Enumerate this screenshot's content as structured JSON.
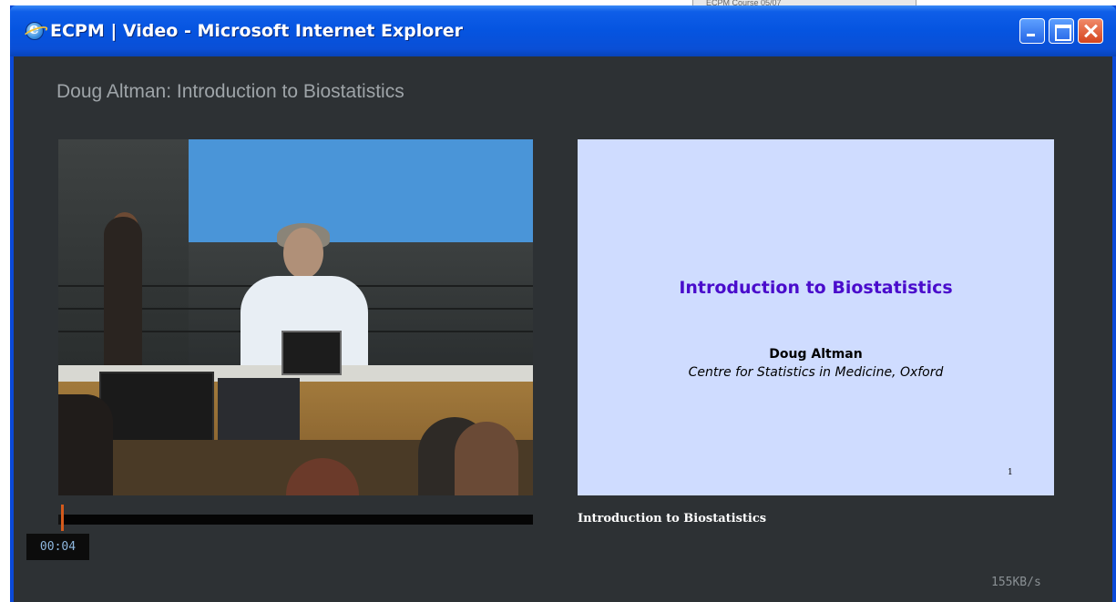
{
  "background": {
    "tab_label": "ECPM Course 05/07"
  },
  "window": {
    "title": "ECPM | Video - Microsoft Internet Explorer",
    "icon": "internet-explorer-icon",
    "controls": [
      "minimize",
      "maximize",
      "close"
    ]
  },
  "page": {
    "title": "Doug Altman: Introduction to Biostatistics"
  },
  "player": {
    "current_time": "00:04",
    "progress_fraction": 0.006,
    "bandwidth": "155KB/s"
  },
  "slide": {
    "title": "Introduction to Biostatistics",
    "author": "Doug Altman",
    "affiliation": "Centre for Statistics in Medicine, Oxford",
    "page_number": "1",
    "caption": "Introduction to Biostatistics"
  },
  "colors": {
    "slide_background": "#cfdcff",
    "slide_title": "#4a0ccc",
    "content_background": "#2d3134",
    "progress_handle": "#d45a1c"
  }
}
